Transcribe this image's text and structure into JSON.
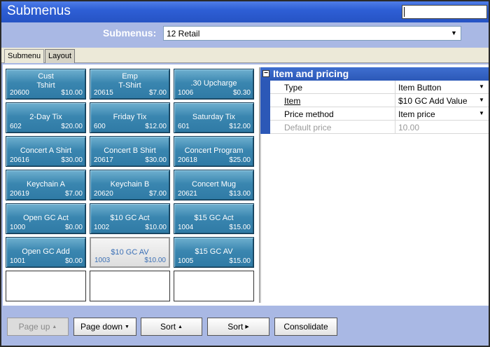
{
  "window": {
    "title": "Submenus",
    "search_value": ""
  },
  "header": {
    "submenus_label": "Submenus:",
    "submenu_selected": "12 Retail"
  },
  "tabs": [
    {
      "label": "Submenu"
    },
    {
      "label": "Layout"
    }
  ],
  "grid": {
    "buttons": [
      {
        "name": "Cust\nTshirt",
        "code": "20600",
        "price": "$10.00"
      },
      {
        "name": "Emp\nT-Shirt",
        "code": "20615",
        "price": "$7.00"
      },
      {
        "name": ".30 Upcharge",
        "code": "1006",
        "price": "$0.30"
      },
      {
        "name": "2-Day Tix",
        "code": "602",
        "price": "$20.00"
      },
      {
        "name": "Friday Tix",
        "code": "600",
        "price": "$12.00"
      },
      {
        "name": "Saturday Tix",
        "code": "601",
        "price": "$12.00"
      },
      {
        "name": "Concert A Shirt",
        "code": "20616",
        "price": "$30.00"
      },
      {
        "name": "Concert B Shirt",
        "code": "20617",
        "price": "$30.00"
      },
      {
        "name": "Concert Program",
        "code": "20618",
        "price": "$25.00"
      },
      {
        "name": "Keychain A",
        "code": "20619",
        "price": "$7.00"
      },
      {
        "name": "Keychain B",
        "code": "20620",
        "price": "$7.00"
      },
      {
        "name": "Concert Mug",
        "code": "20621",
        "price": "$13.00"
      },
      {
        "name": "Open GC Act",
        "code": "1000",
        "price": "$0.00"
      },
      {
        "name": "$10 GC Act",
        "code": "1002",
        "price": "$10.00"
      },
      {
        "name": "$15 GC Act",
        "code": "1004",
        "price": "$15.00"
      },
      {
        "name": "Open GC Add",
        "code": "1001",
        "price": "$0.00"
      },
      {
        "name": "$10 GC AV",
        "code": "1003",
        "price": "$10.00"
      },
      {
        "name": "$15 GC AV",
        "code": "1005",
        "price": "$15.00"
      }
    ]
  },
  "properties": {
    "section_title": "Item and pricing",
    "rows": [
      {
        "key": "Type",
        "value": "Item Button"
      },
      {
        "key": "Item",
        "value": "$10 GC Add Value"
      },
      {
        "key": "Price method",
        "value": "Item price"
      },
      {
        "key": "Default price",
        "value": "10.00"
      }
    ]
  },
  "footer": {
    "page_up": "Page up",
    "page_down": "Page down",
    "sort_up": "Sort",
    "sort_right": "Sort",
    "consolidate": "Consolidate"
  }
}
